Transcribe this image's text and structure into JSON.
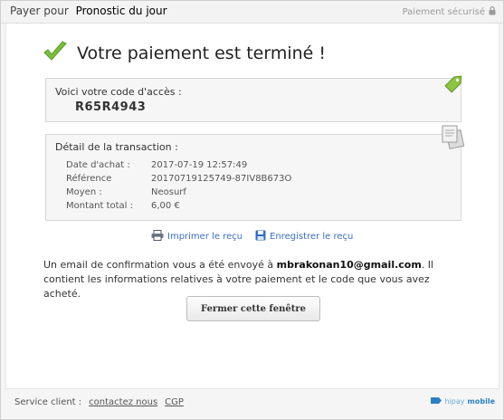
{
  "topbar": {
    "prefix": "Payer pour",
    "merchant": "Pronostic du jour",
    "secure_label": "Paiement sécurisé"
  },
  "header": {
    "title": "Votre paiement est terminé !",
    "icon": "checkmark-icon"
  },
  "access": {
    "label": "Voici votre code d'accès :",
    "code": "R65R4943"
  },
  "transaction": {
    "label": "Détail de la transaction :",
    "rows": [
      {
        "key": "Date d'achat :",
        "value": "2017-07-19 12:57:49"
      },
      {
        "key": "Référence",
        "value": "20170719125749-87IV8B673O"
      },
      {
        "key": "Moyen :",
        "value": "Neosurf"
      },
      {
        "key": "Montant total :",
        "value": "6,00 €"
      }
    ]
  },
  "actions": {
    "print": "Imprimer le reçu",
    "save": "Enregistrer le reçu"
  },
  "message": {
    "part1": "Un email de confirmation vous a été envoyé à ",
    "email": "mbrakonan10@gmail.com",
    "part2": ". Il contient les informations relatives à votre paiement et le code que vous avez acheté."
  },
  "close_button": "Fermer cette fenêtre",
  "footer": {
    "service_label": "Service client :",
    "contact_link": "contactez nous",
    "cgp_link": "CGP"
  },
  "brand": {
    "name": "hipay",
    "suffix": "mobile"
  },
  "colors": {
    "accent_green": "#7bbf3a",
    "link_blue": "#3a6ec4",
    "brand_blue": "#2f7fc4"
  }
}
